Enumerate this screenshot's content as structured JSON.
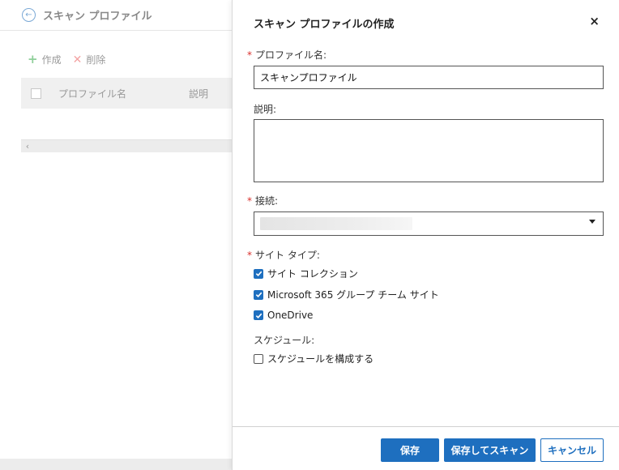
{
  "background": {
    "title": "スキャン プロファイル",
    "toolbar": {
      "create_label": "作成",
      "delete_label": "削除"
    },
    "table": {
      "columns": [
        "プロファイル名",
        "説明"
      ]
    }
  },
  "dialog": {
    "title": "スキャン プロファイルの作成",
    "close_icon": "×",
    "profile_name": {
      "label": "プロファイル名:",
      "value": "スキャンプロファイル",
      "required": true
    },
    "description": {
      "label": "説明:",
      "value": ""
    },
    "connection": {
      "label": "接続:",
      "required": true
    },
    "site_type": {
      "label": "サイト タイプ:",
      "required": true,
      "options": [
        {
          "label": "サイト コレクション",
          "checked": true
        },
        {
          "label": "Microsoft 365 グループ チーム サイト",
          "checked": true
        },
        {
          "label": "OneDrive",
          "checked": true
        }
      ]
    },
    "schedule": {
      "label": "スケジュール:",
      "option": {
        "label": "スケジュールを構成する",
        "checked": false
      }
    },
    "buttons": {
      "save": "保存",
      "save_and_scan": "保存してスキャン",
      "cancel": "キャンセル"
    }
  },
  "colors": {
    "accent": "#1e6fbf",
    "required": "#d9302c"
  }
}
